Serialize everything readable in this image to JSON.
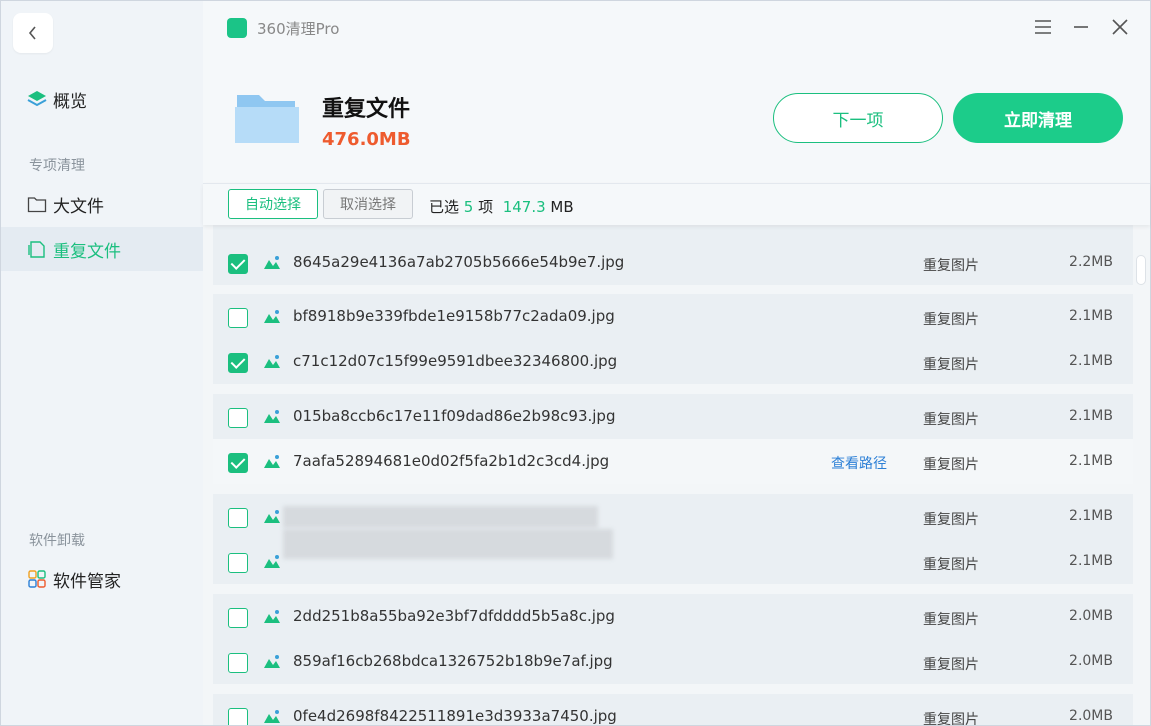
{
  "app": {
    "title": "360清理Pro"
  },
  "sidebar": {
    "items": [
      {
        "label": "概览"
      },
      {
        "label": "大文件"
      },
      {
        "label": "重复文件"
      },
      {
        "label": "软件管家"
      }
    ],
    "section_special": "专项清理",
    "section_uninstall": "软件卸载"
  },
  "header": {
    "title": "重复文件",
    "size": "476.0MB",
    "next_label": "下一项",
    "clean_label": "立即清理"
  },
  "toolbar": {
    "auto_label": "自动选择",
    "cancel_label": "取消选择",
    "sel_prefix": "已选",
    "sel_count": "5",
    "sel_unit": "项",
    "sel_size": "147.3",
    "sel_size_unit": "MB"
  },
  "colors": {
    "accent": "#1bbf7f",
    "size_orange": "#ee5b2e",
    "link": "#2b7fd6"
  },
  "rows": [
    {
      "name": "8645a29e4136a7ab2705b5666e54b9e7.jpg",
      "type": "重复图片",
      "size": "2.2MB",
      "checked": true
    },
    {
      "name": "bf8918b9e339fbde1e9158b77c2ada09.jpg",
      "type": "重复图片",
      "size": "2.1MB",
      "checked": false
    },
    {
      "name": "c71c12d07c15f99e9591dbee32346800.jpg",
      "type": "重复图片",
      "size": "2.1MB",
      "checked": true
    },
    {
      "name": "015ba8ccb6c17e11f09dad86e2b98c93.jpg",
      "type": "重复图片",
      "size": "2.1MB",
      "checked": false
    },
    {
      "name": "7aafa52894681e0d02f5fa2b1d2c3cd4.jpg",
      "type": "重复图片",
      "size": "2.1MB",
      "checked": true,
      "path_label": "查看路径"
    },
    {
      "name": "",
      "type": "重复图片",
      "size": "2.1MB",
      "checked": false
    },
    {
      "name": "",
      "type": "重复图片",
      "size": "2.1MB",
      "checked": false
    },
    {
      "name": "2dd251b8a55ba92e3bf7dfdddd5b5a8c.jpg",
      "type": "重复图片",
      "size": "2.0MB",
      "checked": false
    },
    {
      "name": "859af16cb268bdca1326752b18b9e7af.jpg",
      "type": "重复图片",
      "size": "2.0MB",
      "checked": false
    },
    {
      "name": "0fe4d2698f8422511891e3d3933a7450.jpg",
      "type": "重复图片",
      "size": "2.0MB",
      "checked": false
    }
  ]
}
